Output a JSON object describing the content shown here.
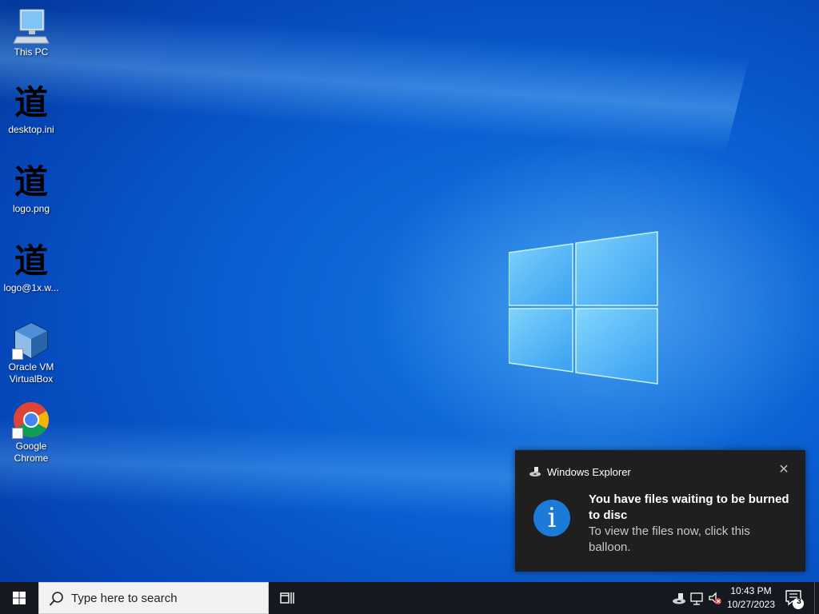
{
  "desktop": {
    "icons": [
      {
        "label": "This PC",
        "icon": "computer-icon"
      },
      {
        "label": "desktop.ini",
        "icon": "kanji-icon",
        "glyph": "道"
      },
      {
        "label": "logo.png",
        "icon": "kanji-icon",
        "glyph": "道"
      },
      {
        "label": "logo@1x.w...",
        "icon": "kanji-icon",
        "glyph": "道"
      },
      {
        "label": "Oracle VM VirtualBox",
        "icon": "virtualbox-icon"
      },
      {
        "label": "Google Chrome",
        "icon": "chrome-icon"
      }
    ]
  },
  "notification": {
    "app_name": "Windows Explorer",
    "title": "You have files waiting to be burned to disc",
    "body": "To view the files now, click this balloon.",
    "close_symbol": "✕",
    "info_symbol": "i"
  },
  "taskbar": {
    "search_placeholder": "Type here to search",
    "time": "10:43 PM",
    "date": "10/27/2023",
    "notification_count": "3"
  },
  "colors": {
    "accent": "#1c7ad8",
    "taskbar": "#15191f",
    "toast_bg": "#1f1f1f"
  }
}
